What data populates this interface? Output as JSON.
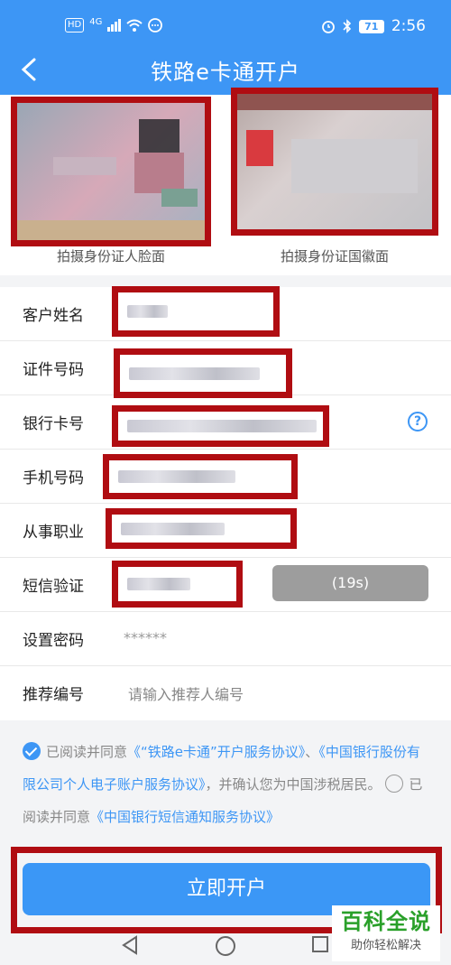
{
  "status_bar": {
    "hd": "HD",
    "network": "4G",
    "battery": "71",
    "time": "2:56"
  },
  "header": {
    "title": "铁路e卡通开户"
  },
  "photos": {
    "front_caption": "拍摄身份证人脸面",
    "back_caption": "拍摄身份证国徽面"
  },
  "form": {
    "name_label": "客户姓名",
    "id_label": "证件号码",
    "card_label": "银行卡号",
    "help": "?",
    "phone_label": "手机号码",
    "job_label": "从事职业",
    "sms_label": "短信验证",
    "countdown": "(19s)",
    "pwd_label": "设置密码",
    "pwd_value": "******",
    "ref_label": "推荐编号",
    "ref_placeholder": "请输入推荐人编号"
  },
  "agreement": {
    "text1": "已阅读并同意",
    "link1": "《“铁路e卡通”开户服务协议》",
    "sep": "、",
    "link2": "《中国银行股份有限公司个人电子账户服务协议》",
    "text2": "，并确认您为中国涉税居民。",
    "text3": "已阅读并同意",
    "link3": "《中国银行短信通知服务协议》"
  },
  "submit": {
    "label": "立即开户"
  },
  "watermark": {
    "line1": "百科全说",
    "line2": "助你轻松解决"
  },
  "colors": {
    "primary": "#3d96f5",
    "highlight": "#b00d12",
    "watermark_green": "#2aa02a"
  }
}
